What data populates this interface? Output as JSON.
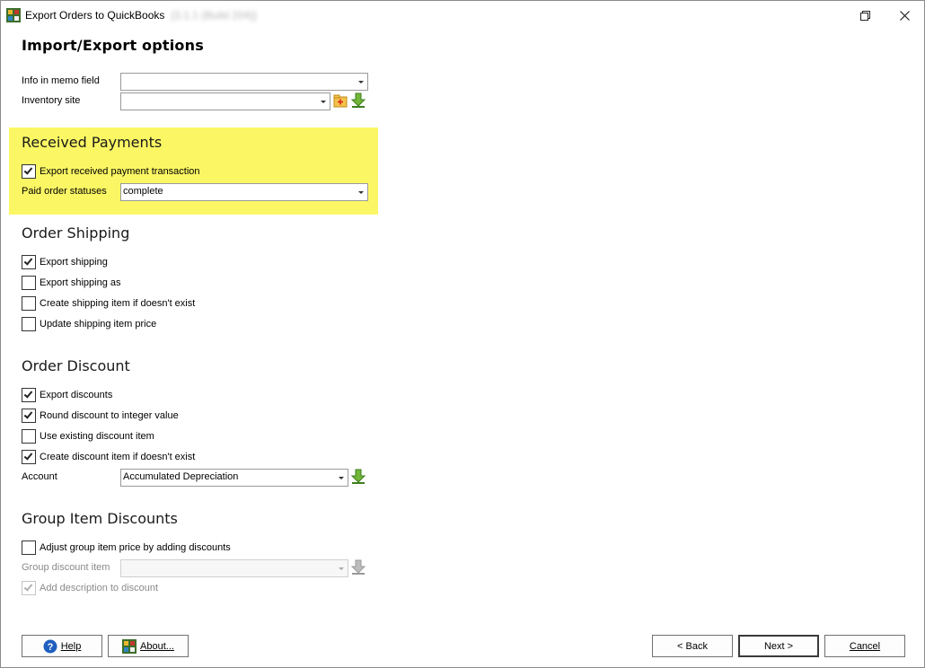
{
  "window": {
    "title": "Export Orders to QuickBooks",
    "version": "[3.1.1 (Build 204)]",
    "restore_icon": "restore-icon",
    "close_icon": "close-icon"
  },
  "page": {
    "title": "Import/Export options"
  },
  "top_fields": {
    "memo_label": "Info in memo field",
    "memo_value": "",
    "site_label": "Inventory site",
    "site_value": ""
  },
  "received_payments": {
    "title": "Received Payments",
    "export_label": "Export received payment transaction",
    "export_checked": true,
    "statuses_label": "Paid order statuses",
    "statuses_value": "complete",
    "highlight_color": "#fbf764"
  },
  "order_shipping": {
    "title": "Order Shipping",
    "options": [
      {
        "label": "Export shipping",
        "checked": true
      },
      {
        "label": "Export shipping as",
        "checked": false
      },
      {
        "label": "Create shipping item if doesn't exist",
        "checked": false
      },
      {
        "label": "Update shipping item price",
        "checked": false
      }
    ]
  },
  "order_discount": {
    "title": "Order Discount",
    "options": [
      {
        "label": "Export discounts",
        "checked": true
      },
      {
        "label": "Round discount to integer value",
        "checked": true
      },
      {
        "label": "Use existing discount item",
        "checked": false
      },
      {
        "label": "Create discount item if doesn't exist",
        "checked": true
      }
    ],
    "account_label": "Account",
    "account_value": "Accumulated Depreciation"
  },
  "group_item_discounts": {
    "title": "Group Item Discounts",
    "adjust_label": "Adjust group item price by adding discounts",
    "adjust_checked": false,
    "group_item_label": "Group discount item",
    "group_item_value": "",
    "add_desc_label": "Add description to discount",
    "add_desc_checked": true
  },
  "footer": {
    "help_label": "Help",
    "about_label": "About...",
    "back_label": "< Back",
    "next_label": "Next >",
    "cancel_label": "Cancel"
  },
  "colors": {
    "accent_green": "#5aa02c",
    "folder_orange": "#f0a830",
    "help_blue": "#1f5fbf"
  }
}
